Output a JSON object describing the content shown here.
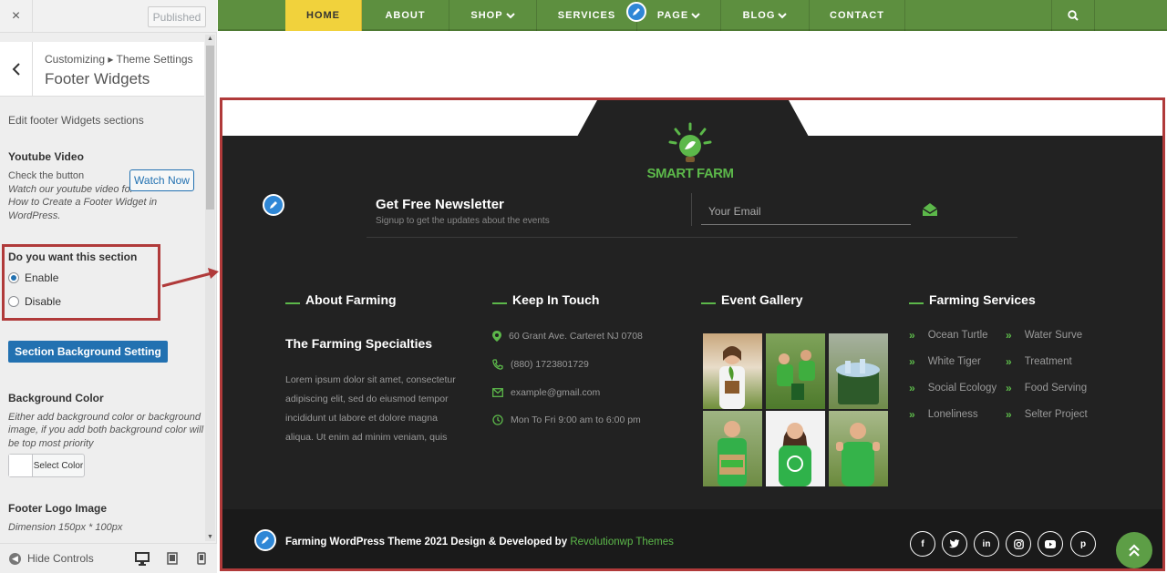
{
  "sidebar": {
    "close_icon": "×",
    "published_label": "Published",
    "breadcrumb": "Customizing ▸ Theme Settings",
    "title": "Footer Widgets",
    "description": "Edit footer Widgets sections",
    "youtube": {
      "heading": "Youtube Video",
      "check_text": "Check the button",
      "watch_label": "Watch Now",
      "hint": [
        "Watch our youtube video for",
        "How to Create a Footer Widget in",
        "WordPress."
      ]
    },
    "section_toggle": {
      "heading": "Do you want this section",
      "options": [
        "Enable",
        "Disable"
      ],
      "selected": "Enable"
    },
    "bg_button_label": "Section Background Setting",
    "bg_color": {
      "heading": "Background Color",
      "hint": [
        "Either add background color or background",
        "image, if you add both background color will",
        "be top most priority"
      ],
      "select_label": "Select Color"
    },
    "logo": {
      "heading": "Footer Logo Image",
      "dimension": "Dimension 150px * 100px"
    },
    "hide_controls_label": "Hide Controls"
  },
  "nav": {
    "items": [
      "HOME",
      "ABOUT",
      "SHOP",
      "SERVICES",
      "PAGE",
      "BLOG",
      "CONTACT"
    ],
    "active": "HOME",
    "accent": "#5d8f3f",
    "active_color": "#f1d23c"
  },
  "footer": {
    "logo_text": "SMART FARM",
    "newsletter": {
      "title": "Get Free Newsletter",
      "subtitle": "Signup to get the updates about the events",
      "placeholder": "Your Email"
    },
    "columns": {
      "about": {
        "heading": "About Farming",
        "subheading": "The Farming Specialties",
        "text": [
          "Lorem ipsum dolor sit amet, consectetur",
          "adipiscing elit, sed do eiusmod tempor",
          "incididunt ut labore et dolore magna",
          "aliqua. Ut enim ad minim veniam, quis"
        ]
      },
      "touch": {
        "heading": "Keep In Touch",
        "address": "60 Grant Ave. Carteret NJ 0708",
        "phone": "(880) 1723801729",
        "email": "example@gmail.com",
        "hours": "Mon To Fri 9:00 am to 6:00 pm"
      },
      "gallery": {
        "heading": "Event Gallery"
      },
      "services": {
        "heading": "Farming Services",
        "left": [
          "Ocean Turtle",
          "White Tiger",
          "Social Ecology",
          "Loneliness"
        ],
        "right": [
          "Water Surve",
          "Treatment",
          "Food Serving",
          "Selter Project"
        ]
      }
    },
    "copyright": "Farming WordPress Theme 2021 Design & Developed by ",
    "copyright_brand": "Revolutionwp Themes",
    "socials": [
      "f",
      "t",
      "in",
      "ig",
      "yt",
      "p"
    ],
    "brand_color": "#5cb84a"
  }
}
